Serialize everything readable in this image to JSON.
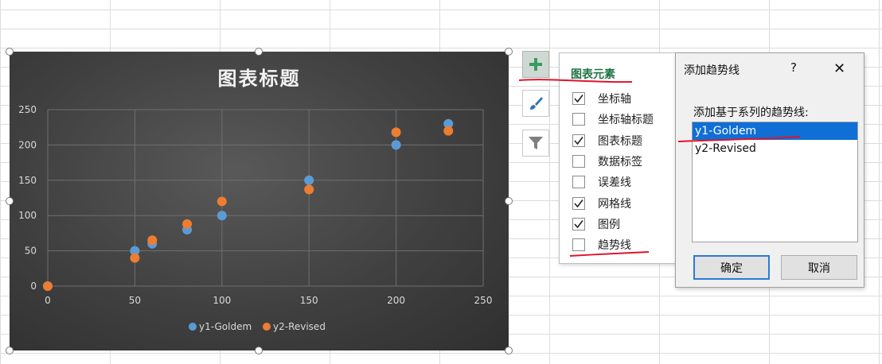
{
  "chart": {
    "title": "图表标题",
    "legend": [
      "y1-Goldem",
      "y2-Revised"
    ]
  },
  "chart_data": {
    "type": "scatter",
    "title": "图表标题",
    "xlabel": "",
    "ylabel": "",
    "xlim": [
      0,
      250
    ],
    "ylim": [
      0,
      250
    ],
    "x_ticks": [
      "0",
      "50",
      "100",
      "150",
      "200",
      "250"
    ],
    "y_ticks": [
      "0",
      "50",
      "100",
      "150",
      "200",
      "250"
    ],
    "grid": true,
    "legend_position": "bottom",
    "series": [
      {
        "name": "y1-Goldem",
        "color": "#5b9bd5",
        "x": [
          0,
          50,
          60,
          80,
          100,
          150,
          200,
          230
        ],
        "y": [
          0,
          50,
          60,
          80,
          100,
          150,
          200,
          230
        ]
      },
      {
        "name": "y2-Revised",
        "color": "#ed7d31",
        "x": [
          0,
          50,
          60,
          80,
          100,
          150,
          200,
          230
        ],
        "y": [
          0,
          40,
          65,
          88,
          120,
          137,
          218,
          220
        ]
      }
    ]
  },
  "side_buttons": [
    {
      "icon": "plus-icon",
      "active": true
    },
    {
      "icon": "brush-icon",
      "active": false
    },
    {
      "icon": "filter-icon",
      "active": false
    }
  ],
  "flyout": {
    "title": "图表元素",
    "options": [
      {
        "label": "坐标轴",
        "checked": true
      },
      {
        "label": "坐标轴标题",
        "checked": false
      },
      {
        "label": "图表标题",
        "checked": true
      },
      {
        "label": "数据标签",
        "checked": false
      },
      {
        "label": "误差线",
        "checked": false
      },
      {
        "label": "网格线",
        "checked": true
      },
      {
        "label": "图例",
        "checked": true
      },
      {
        "label": "趋势线",
        "checked": false
      }
    ]
  },
  "dialog": {
    "title": "添加趋势线",
    "help": "?",
    "close": "✕",
    "prompt": "添加基于系列的趋势线:",
    "series": [
      "y1-Goldem",
      "y2-Revised"
    ],
    "selected_index": 0,
    "ok_label": "确定",
    "cancel_label": "取消"
  },
  "colors": {
    "accent": "#217346",
    "annotation": "#e0142b",
    "selection": "#0f6fd6"
  }
}
